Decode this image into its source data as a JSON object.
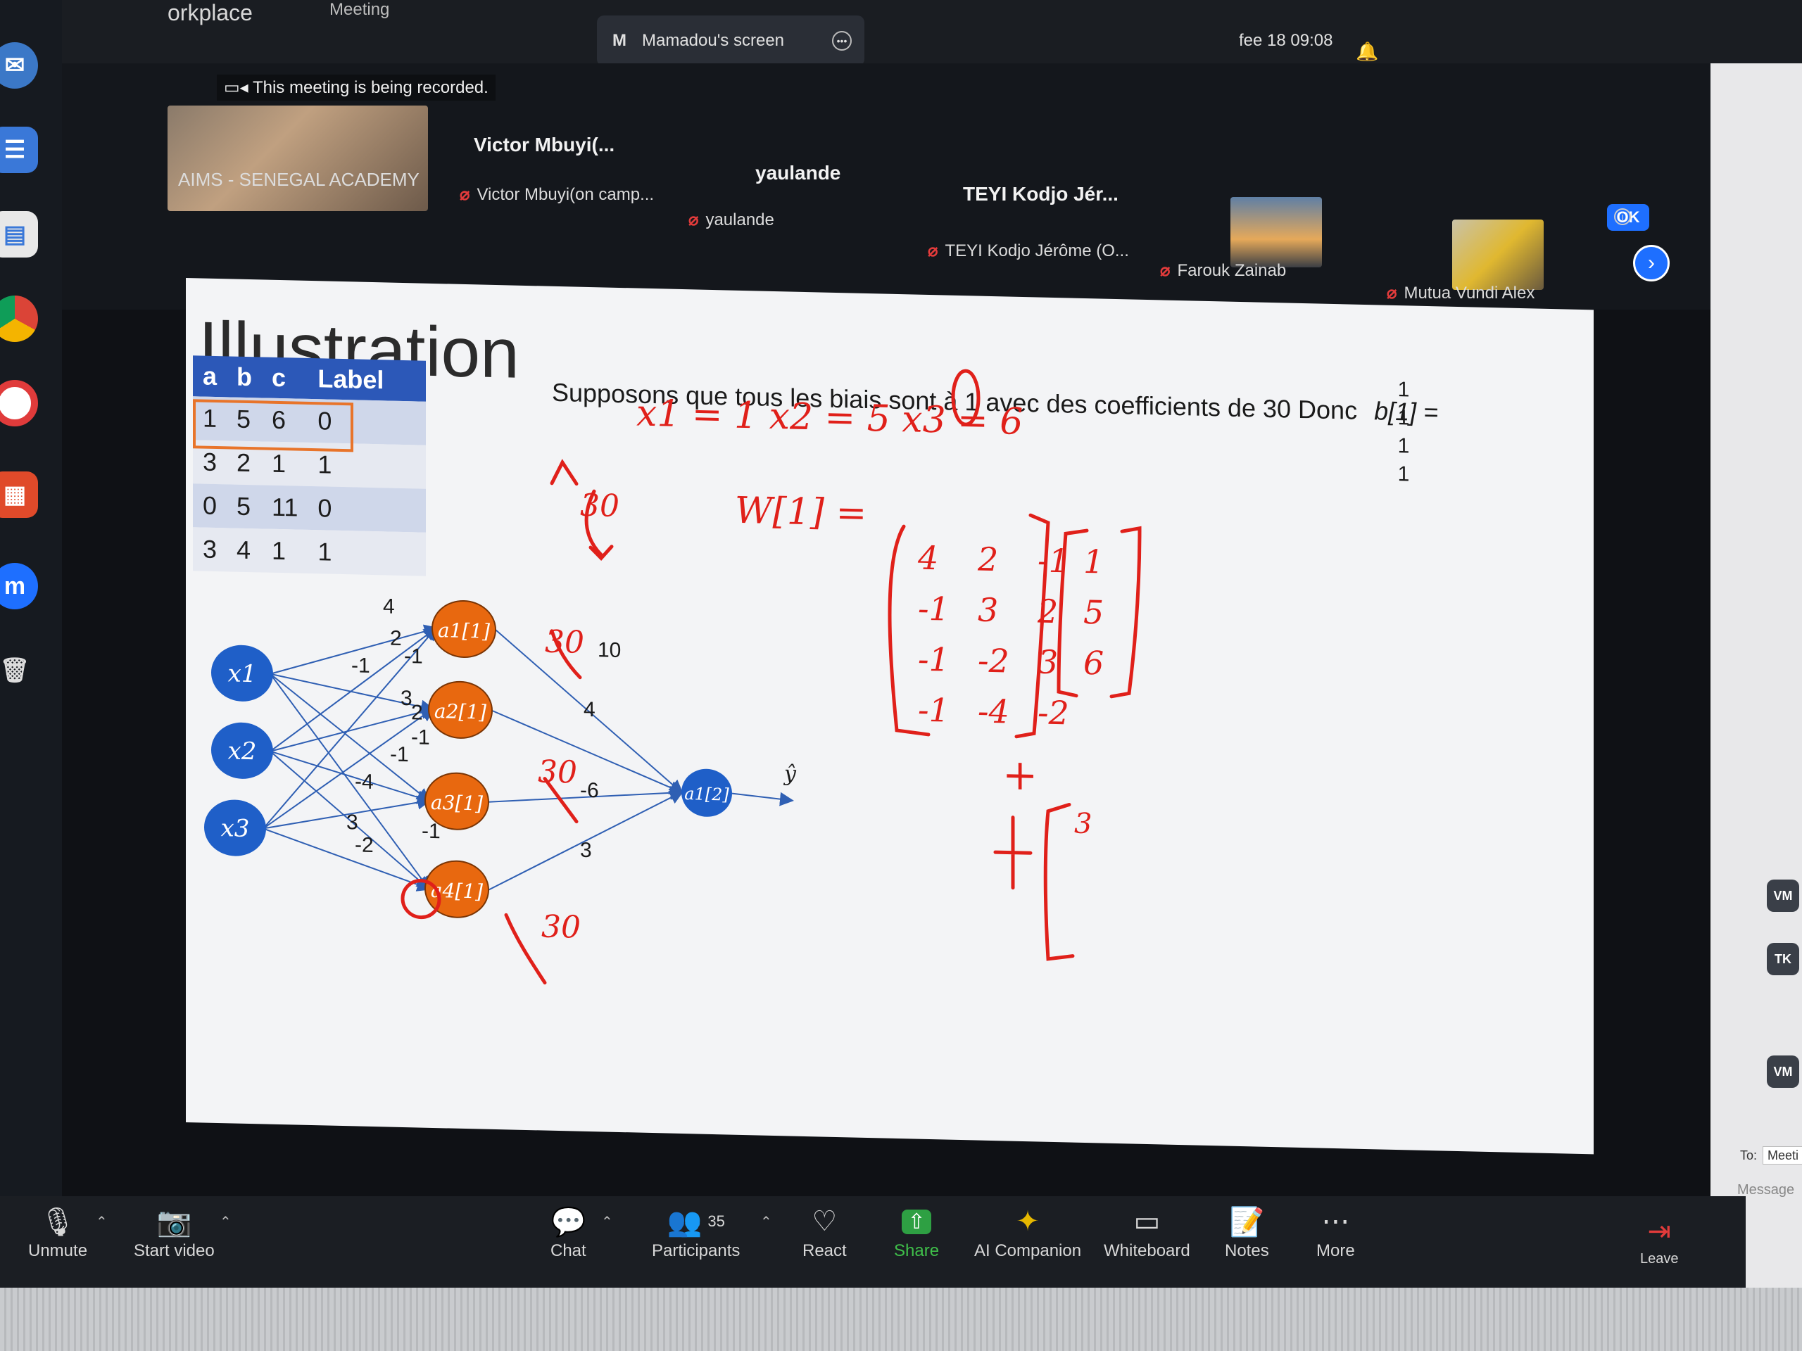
{
  "app": {
    "name": "orkplace",
    "meeting_label": "Meeting"
  },
  "screen_share": {
    "label": "Mamadou's screen",
    "initial": "M"
  },
  "clock": "fee 18  09:08",
  "recording_notice": "This meeting is being recorded.",
  "participants_strip": [
    {
      "name": "AIMS - SENEGAL ACADEMY",
      "sub": ""
    },
    {
      "name": "Victor Mbuyi(...",
      "sub": "Victor Mbuyi(on camp..."
    },
    {
      "name": "yaulande",
      "sub": "yaulande"
    },
    {
      "name": "TEYI Kodjo Jér...",
      "sub": "TEYI Kodjo Jérôme (O..."
    },
    {
      "name": "",
      "sub": "Farouk Zainab"
    },
    {
      "name": "",
      "sub": "Mutua Vundi Alex"
    }
  ],
  "ok_label": "OK",
  "slide": {
    "title": "Illustration",
    "text": "Supposons que tous les biais sont à 1 avec des coefficients de 30 Donc",
    "bias_label": "b[1] =",
    "bias_values": [
      "1",
      "1",
      "1",
      "1"
    ],
    "table": {
      "headers": [
        "a",
        "b",
        "c",
        "Label"
      ],
      "rows": [
        [
          "1",
          "5",
          "6",
          "0"
        ],
        [
          "3",
          "2",
          "1",
          "1"
        ],
        [
          "0",
          "5",
          "11",
          "0"
        ],
        [
          "3",
          "4",
          "1",
          "1"
        ]
      ]
    },
    "inputs": [
      "x1",
      "x2",
      "x3"
    ],
    "hidden": [
      "a1[1]",
      "a2[1]",
      "a3[1]",
      "a4[1]"
    ],
    "output": "a1[2]",
    "yhat": "ŷ",
    "input_weights": [
      "4",
      "2",
      "-1",
      "-1",
      "3",
      "2",
      "-1",
      "-1",
      "-4",
      "3",
      "-1",
      "-2"
    ],
    "output_weights": [
      "10",
      "4",
      "-6",
      "3"
    ],
    "annotations": {
      "x_values": "x1 = 1    x2 = 5    x3 = 6",
      "w_label": "W[1] =",
      "w_matrix": [
        [
          "4",
          "2",
          "-1"
        ],
        [
          "-1",
          "3",
          "2"
        ],
        [
          "-1",
          "-2",
          "3"
        ],
        [
          "-1",
          "-4",
          "-2"
        ]
      ],
      "x_vector": [
        "1",
        "5",
        "6"
      ],
      "bias_notes": [
        "30",
        "30",
        "30",
        "30"
      ],
      "plus": "+",
      "partial": "3"
    }
  },
  "side_badges": [
    "VM",
    "TK",
    "VM"
  ],
  "chat": {
    "to_label": "To:",
    "to_value": "Meeti",
    "placeholder": "Message"
  },
  "controls": {
    "unmute": "Unmute",
    "start_video": "Start video",
    "chat": "Chat",
    "participants": "Participants",
    "participants_count": "35",
    "react": "React",
    "share": "Share",
    "ai": "AI Companion",
    "whiteboard": "Whiteboard",
    "notes": "Notes",
    "more": "More",
    "leave": "Leave"
  }
}
